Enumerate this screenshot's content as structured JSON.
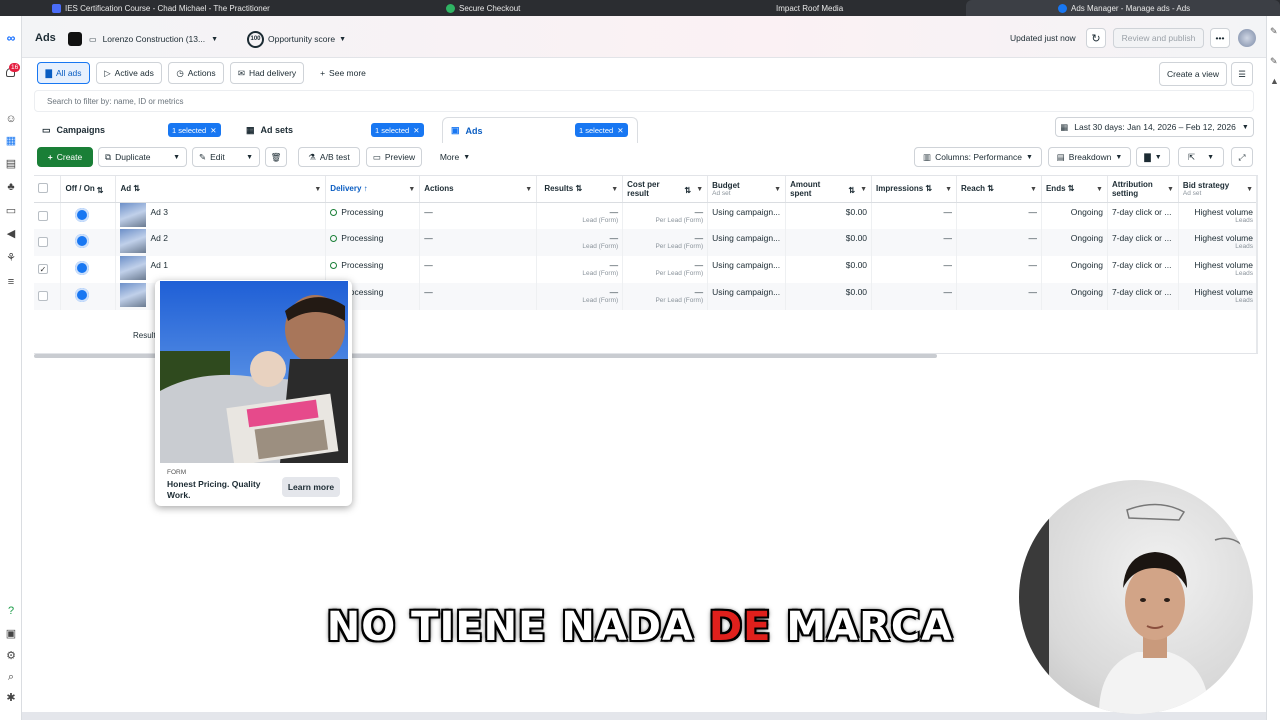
{
  "browser_tabs": [
    {
      "label": "IES Certification Course - Chad Michael - The Practitioner",
      "icon": "file-icon"
    },
    {
      "label": "Secure Checkout",
      "icon": "lock-icon"
    },
    {
      "label": "Impact Roof Media",
      "icon": "globe-icon"
    },
    {
      "label": "Ads Manager - Manage ads - Ads",
      "icon": "facebook-icon"
    }
  ],
  "notification_count": "16",
  "header": {
    "title": "Ads",
    "account_name": "Lorenzo Construction (13...",
    "opportunity_score": "100",
    "opportunity_label": "Opportunity score",
    "updated": "Updated just now",
    "review_publish": "Review and publish"
  },
  "filters": {
    "all_ads": "All ads",
    "active_ads": "Active ads",
    "actions": "Actions",
    "had_delivery": "Had delivery",
    "see_more": "See more",
    "create_view": "Create a view"
  },
  "search": {
    "placeholder": "Search to filter by: name, ID or metrics"
  },
  "levels": {
    "campaigns": "Campaigns",
    "ad_sets": "Ad sets",
    "ads": "Ads",
    "selected_badge": "1 selected"
  },
  "date_range": "Last 30 days: Jan 14, 2026 – Feb 12, 2026",
  "toolbar": {
    "create": "Create",
    "duplicate": "Duplicate",
    "edit": "Edit",
    "ab_test": "A/B test",
    "preview": "Preview",
    "more": "More",
    "columns": "Columns: Performance",
    "breakdown": "Breakdown"
  },
  "columns": {
    "off_on": "Off / On",
    "ad": "Ad",
    "delivery": "Delivery",
    "actions": "Actions",
    "results": "Results",
    "cost_per_result": "Cost per result",
    "budget": "Budget",
    "budget_sub": "Ad set",
    "amount_spent": "Amount spent",
    "impressions": "Impressions",
    "reach": "Reach",
    "ends": "Ends",
    "attribution": "Attribution setting",
    "bid_strategy": "Bid strategy",
    "bid_sub": "Ad set"
  },
  "rows": [
    {
      "name": "Ad 3",
      "delivery": "Processing",
      "actions": "—",
      "results": "—",
      "results_sub": "Lead (Form)",
      "cpr": "—",
      "cpr_sub": "Per Lead (Form)",
      "budget": "Using campaign...",
      "spent": "$0.00",
      "impressions": "—",
      "reach": "—",
      "ends": "Ongoing",
      "attribution": "7-day click or ...",
      "bid": "Highest volume",
      "bid_sub": "Leads",
      "checked": ""
    },
    {
      "name": "Ad 2",
      "delivery": "Processing",
      "actions": "—",
      "results": "—",
      "results_sub": "Lead (Form)",
      "cpr": "—",
      "cpr_sub": "Per Lead (Form)",
      "budget": "Using campaign...",
      "spent": "$0.00",
      "impressions": "—",
      "reach": "—",
      "ends": "Ongoing",
      "attribution": "7-day click or ...",
      "bid": "Highest volume",
      "bid_sub": "Leads",
      "checked": ""
    },
    {
      "name": "Ad 1",
      "delivery": "Processing",
      "actions": "—",
      "results": "—",
      "results_sub": "Lead (Form)",
      "cpr": "—",
      "cpr_sub": "Per Lead (Form)",
      "budget": "Using campaign...",
      "spent": "$0.00",
      "impressions": "—",
      "reach": "—",
      "ends": "Ongoing",
      "attribution": "7-day click or ...",
      "bid": "Highest volume",
      "bid_sub": "Leads",
      "checked": "✓"
    },
    {
      "name": "",
      "delivery": "Processing",
      "actions": "—",
      "results": "—",
      "results_sub": "Lead (Form)",
      "cpr": "—",
      "cpr_sub": "Per Lead (Form)",
      "budget": "Using campaign...",
      "spent": "$0.00",
      "impressions": "—",
      "reach": "—",
      "ends": "Ongoing",
      "attribution": "7-day click or ...",
      "bid": "Highest volume",
      "bid_sub": "Leads",
      "checked": ""
    }
  ],
  "results_footer": "Results f",
  "ad_preview": {
    "form_label": "FORM",
    "headline": "Honest Pricing. Quality Work.",
    "cta": "Learn more"
  },
  "caption": {
    "before": "NO TIENE NADA ",
    "highlight": "DE",
    "after": " MARCA",
    "highlight_color": "#e0201c"
  }
}
